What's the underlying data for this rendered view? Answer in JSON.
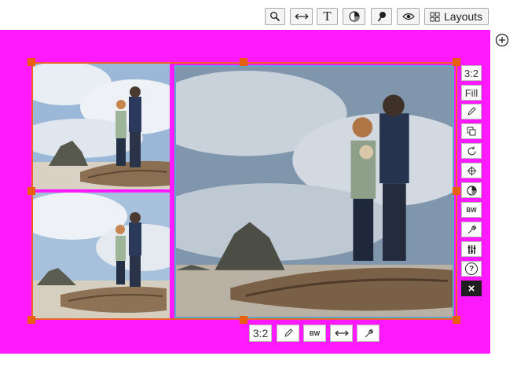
{
  "toolbar": {
    "layouts_label": "Layouts",
    "text_tool_glyph": "T"
  },
  "icons": [
    "search-icon",
    "resize-horizontal-icon",
    "text-icon",
    "color-wheel-icon",
    "pin-icon",
    "eye-icon",
    "grid-icon",
    "add-circle-icon",
    "pencil-icon",
    "duplicate-icon",
    "rotate-icon",
    "crosshair-icon",
    "wrench-icon",
    "sliders-icon",
    "help-icon",
    "close-icon"
  ],
  "side_panel": {
    "ratio_label": "3:2",
    "fill_label": "Fill",
    "bw_label": "BW",
    "help_glyph": "?",
    "close_glyph": "×"
  },
  "bottom_bar": {
    "ratio_label": "3:2",
    "bw_label": "BW"
  },
  "colors": {
    "canvas_bg": "#ff19ff",
    "selection_border": "#e8642a",
    "handle": "#e8600e",
    "active_photo_border": "#5fa8c8"
  }
}
